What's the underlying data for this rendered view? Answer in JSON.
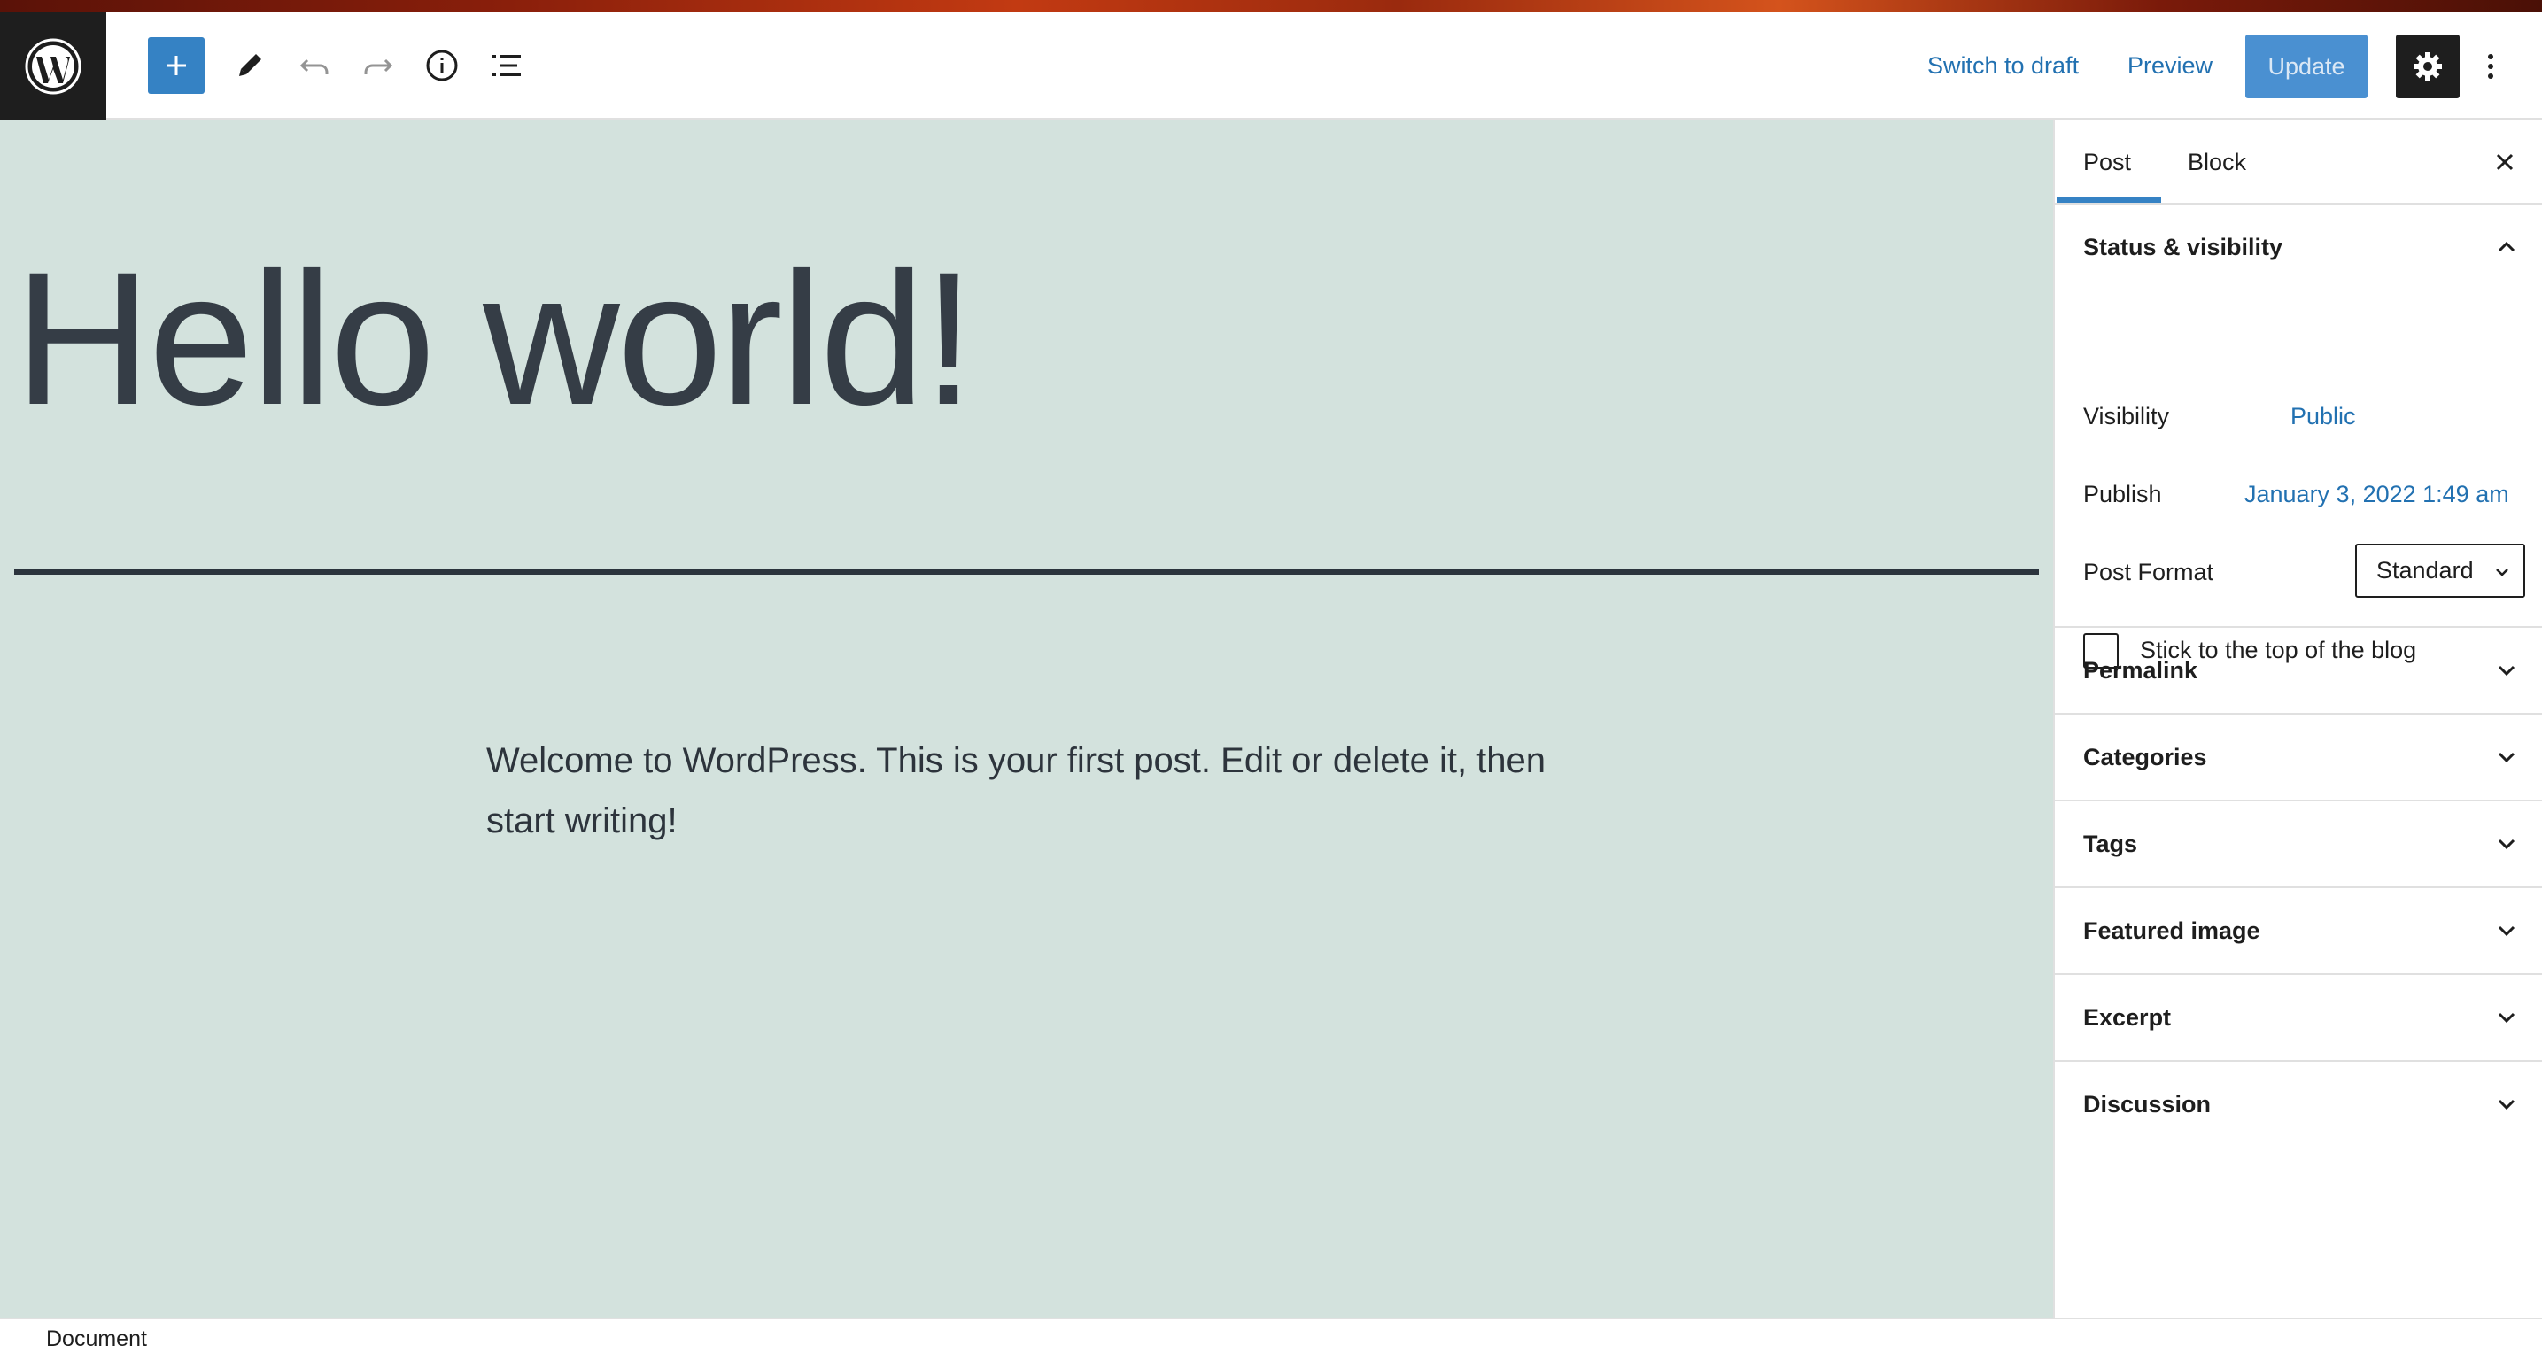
{
  "header": {
    "logo_icon": "wordpress-logo-icon",
    "toolbar_icons": [
      "plus-icon",
      "pencil-icon",
      "undo-icon",
      "redo-icon",
      "info-icon",
      "list-view-icon"
    ],
    "switch_to_draft_label": "Switch to draft",
    "preview_label": "Preview",
    "update_label": "Update",
    "settings_icon": "gear-icon",
    "more_icon": "more-vertical-icon"
  },
  "post": {
    "title": "Hello world!",
    "body": "Welcome to WordPress. This is your first post. Edit or delete it, then start writing!"
  },
  "sidebar": {
    "tabs": [
      {
        "label": "Post",
        "active": true
      },
      {
        "label": "Block",
        "active": false
      }
    ],
    "status_visibility": {
      "title": "Status & visibility",
      "visibility_label": "Visibility",
      "visibility_value": "Public",
      "publish_label": "Publish",
      "publish_value": "January 3, 2022 1:49 am",
      "post_format_label": "Post Format",
      "post_format_value": "Standard",
      "sticky_label": "Stick to the top of the blog",
      "sticky_checked": false
    },
    "panels": [
      {
        "title": "Permalink"
      },
      {
        "title": "Categories"
      },
      {
        "title": "Tags"
      },
      {
        "title": "Featured image"
      },
      {
        "title": "Excerpt"
      },
      {
        "title": "Discussion"
      }
    ]
  },
  "footer": {
    "breadcrumb": "Document"
  },
  "colors": {
    "accent": "#3582c4",
    "link": "#2271b1",
    "canvas_background": "#d3e2dd",
    "update_button": "#4a90d1",
    "dark": "#1e1e1e"
  }
}
